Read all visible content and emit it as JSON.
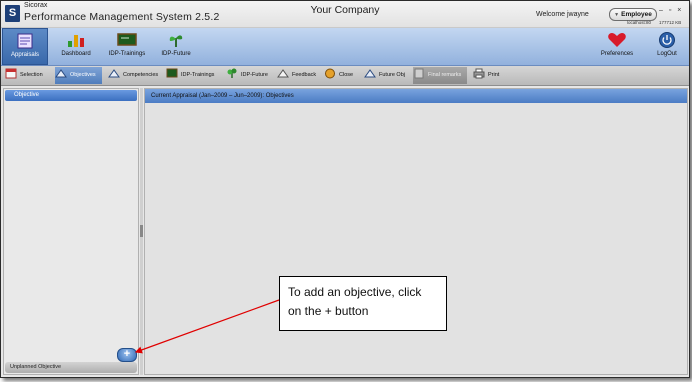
{
  "window": {
    "brand": "Sicorax",
    "app_title": "Performance Management System 2.5.2",
    "company": "Your Company",
    "welcome": "Welcome jwayne",
    "role": "Employee",
    "host": "localhost:80",
    "memory": "177712 KB",
    "window_controls": "– ▫ ×"
  },
  "toolbar": [
    {
      "label": "Appraisals",
      "icon": "appraisals-icon",
      "active": true
    },
    {
      "label": "Dashboard",
      "icon": "dashboard-chart-icon"
    },
    {
      "label": "IDP-Trainings",
      "icon": "trainings-board-icon"
    },
    {
      "label": "IDP-Future",
      "icon": "future-plant-icon"
    },
    {
      "label": "Preferences",
      "icon": "heart-icon"
    },
    {
      "label": "LogOut",
      "icon": "power-icon"
    }
  ],
  "steps": [
    {
      "label": "Selection",
      "icon": "selection-icon"
    },
    {
      "label": "Objectives",
      "icon": "objectives-icon",
      "state": "current"
    },
    {
      "label": "Competencies",
      "icon": "competencies-icon"
    },
    {
      "label": "IDP-Trainings",
      "icon": "trainings-icon"
    },
    {
      "label": "IDP-Future",
      "icon": "future-icon"
    },
    {
      "label": "Feedback",
      "icon": "feedback-icon"
    },
    {
      "label": "Close",
      "icon": "close-step-icon"
    },
    {
      "label": "Future Obj",
      "icon": "future-obj-icon"
    },
    {
      "label": "Final remarks",
      "icon": "final-remarks-icon",
      "state": "disabled"
    },
    {
      "label": "Print",
      "icon": "printer-icon"
    }
  ],
  "left_panel": {
    "header": "Objective",
    "footer": "Unplanned Objective",
    "add_button": "+"
  },
  "right_panel": {
    "header": "Current Appraisal (Jan–2009 – Jun–2009): Objectives"
  },
  "callout": {
    "text": "To add an objective, click on the + button"
  },
  "colors": {
    "toolbar": "#a9c4ea",
    "header_blue": "#4b7cc4",
    "arrow": "#e00000"
  }
}
